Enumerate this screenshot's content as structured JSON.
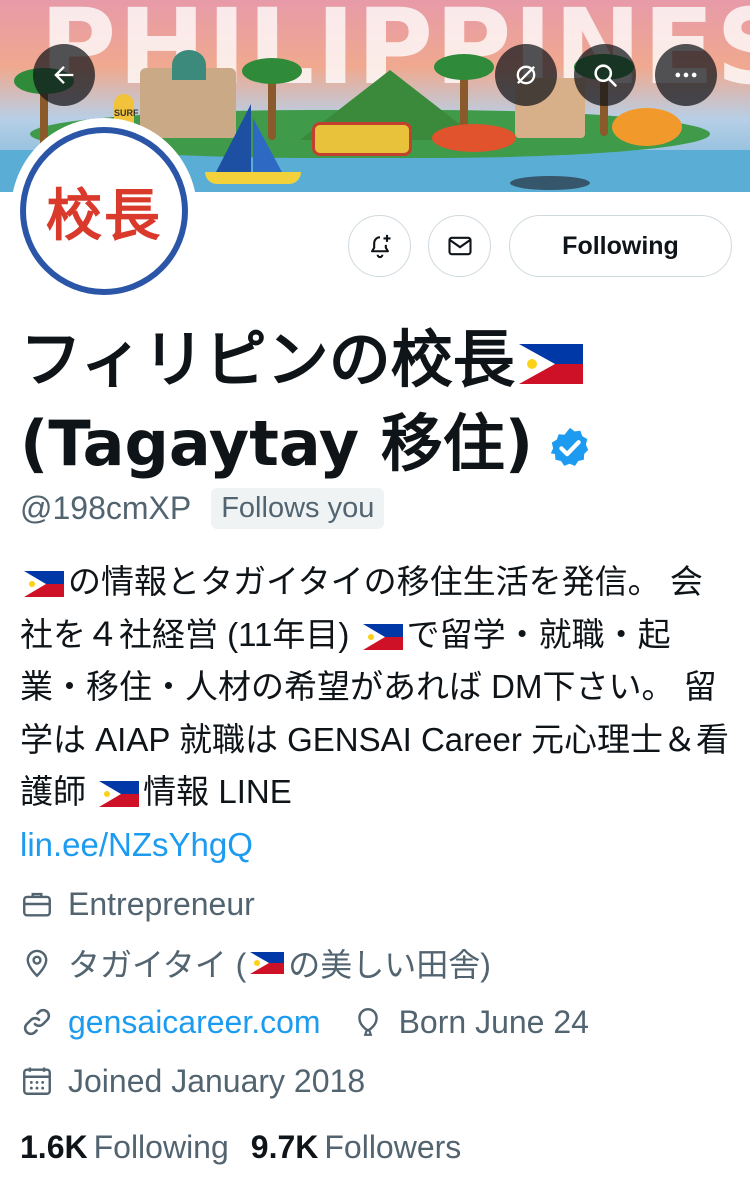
{
  "banner": {
    "title": "PHILIPPINES",
    "surf_text": "SURF"
  },
  "header_buttons": {
    "back": "back-arrow-icon",
    "translate": "hide-icon",
    "search": "search-icon",
    "more": "more-icon"
  },
  "profile": {
    "avatar_text": "校長",
    "actions": {
      "notify_icon": "bell-plus-icon",
      "message_icon": "mail-icon",
      "following_label": "Following"
    },
    "name_line1": "フィリピンの校長",
    "name_line2": "(Tagaytay 移住)",
    "handle": "@198cmXP",
    "follows_you": "Follows you",
    "bio": {
      "part1": "の情報とタガイタイの移住生活を発信。 会社を４社経営 (11年目)",
      "part2": "で留学・就職・起業・移住・人材の希望があれば DM下さい。 留学は AIAP 就職は GENSAI Career 元心理士＆看護師",
      "part3": "情報 LINE",
      "link": "lin.ee/NZsYhgQ"
    },
    "profession": "Entrepreneur",
    "location_pre": "タガイタイ (",
    "location_post": "の美しい田舎)",
    "website": "gensaicareer.com",
    "birthday": "Born June 24",
    "joined": "Joined January 2018",
    "following_count": "1.6K",
    "following_label": "Following",
    "followers_count": "9.7K",
    "followers_label": "Followers"
  },
  "colors": {
    "accent": "#1d9bf0",
    "secondary_text": "#536471",
    "primary_text": "#0f1419"
  }
}
